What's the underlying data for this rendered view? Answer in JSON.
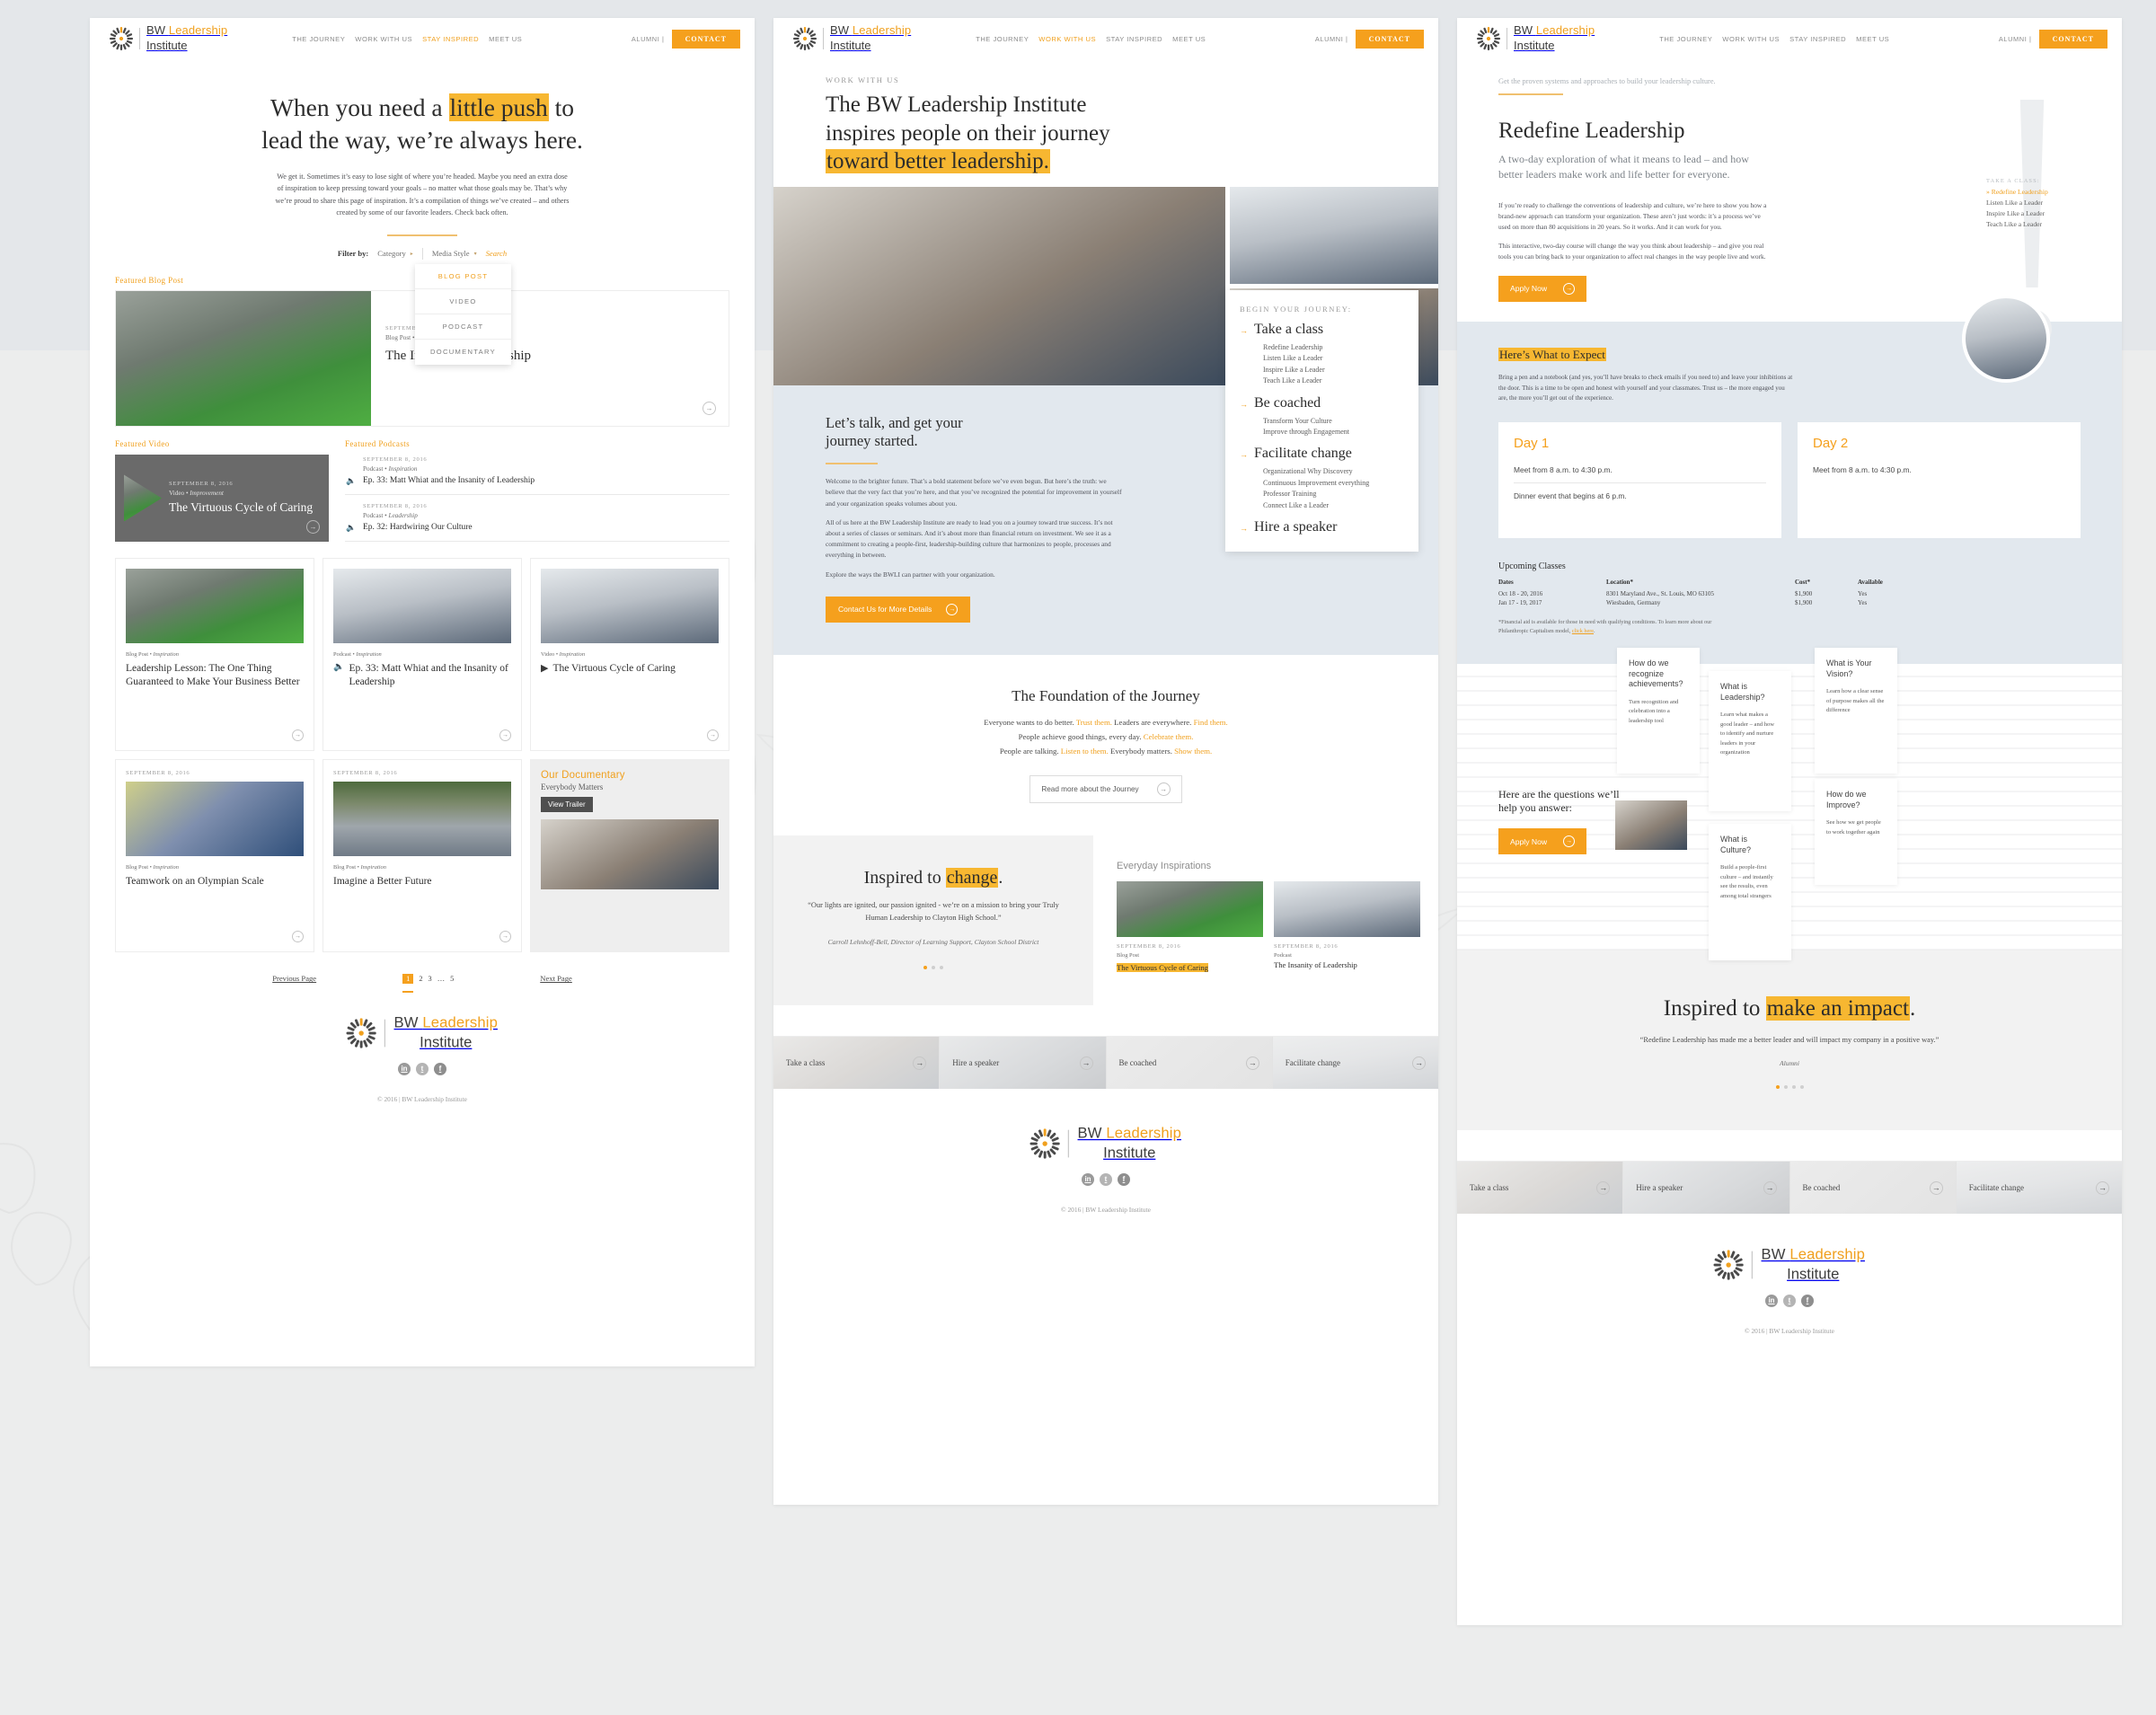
{
  "brand": {
    "line1_plain": "BW ",
    "line1_accent": "Leadership",
    "line2": "Institute",
    "accent_color": "#f0a01e"
  },
  "nav": {
    "items": [
      {
        "label": "THE JOURNEY",
        "active": false
      },
      {
        "label": "WORK WITH US",
        "active": false
      },
      {
        "label": "STAY INSPIRED",
        "active": true
      },
      {
        "label": "MEET US",
        "active": false
      }
    ],
    "alumni_label": "ALUMNI |",
    "contact_label": "CONTACT"
  },
  "nav2": {
    "items": [
      {
        "label": "THE JOURNEY",
        "active": false
      },
      {
        "label": "WORK WITH US",
        "active": true
      },
      {
        "label": "STAY INSPIRED",
        "active": false
      },
      {
        "label": "MEET US",
        "active": false
      }
    ]
  },
  "nav3": {
    "items": [
      {
        "label": "THE JOURNEY",
        "active": false
      },
      {
        "label": "WORK WITH US",
        "active": false
      },
      {
        "label": "STAY INSPIRED",
        "active": false
      },
      {
        "label": "MEET US",
        "active": false
      }
    ]
  },
  "panel1": {
    "hero_before": "When you need a ",
    "hero_highlight": "little push",
    "hero_after": " to",
    "hero_line2": "lead the way, we’re always here.",
    "intro": "We get it. Sometimes it’s easy to lose sight of where you’re headed. Maybe you need an extra dose of inspiration to keep pressing toward your goals – no matter what those goals may be. That’s why we’re proud to share this page of inspiration. It’s a compilation of things we’ve created – and others created by some of our favorite leaders. Check back often.",
    "filter": {
      "label": "Filter by:",
      "category_label": "Category",
      "media_label": "Media Style",
      "search_label": "Search",
      "dropdown_items": [
        {
          "label": "BLOG POST",
          "selected": true
        },
        {
          "label": "VIDEO",
          "selected": false
        },
        {
          "label": "PODCAST",
          "selected": false
        },
        {
          "label": "DOCUMENTARY",
          "selected": false
        }
      ]
    },
    "featured_blog_label": "Featured Blog Post",
    "featured_blog": {
      "date": "SEPTEMBER 8, 2016",
      "category": "Blog Post",
      "tag": "Inspiration",
      "title": "The Insanity of Leadership"
    },
    "featured_video_label": "Featured Video",
    "featured_video": {
      "date": "SEPTEMBER 8, 2016",
      "category": "Video",
      "tag": "Improvement",
      "title": "The Virtuous Cycle of Caring"
    },
    "featured_podcasts_label": "Featured Podcasts",
    "podcasts": [
      {
        "date": "SEPTEMBER 8, 2016",
        "category": "Podcast",
        "tag": "Inspiration",
        "title": "Ep. 33: Matt Whiat and the Insanity of Leadership"
      },
      {
        "date": "SEPTEMBER 8, 2016",
        "category": "Podcast",
        "tag": "Leadership",
        "title": "Ep. 32: Hardwiring Our Culture"
      }
    ],
    "cards": [
      {
        "date": "",
        "category": "Blog Post",
        "tag": "Inspiration",
        "title": "Leadership Lesson: The One Thing Guaranteed to Make Your Business Better",
        "icon": ""
      },
      {
        "date": "",
        "category": "Podcast",
        "tag": "Inspiration",
        "title": "Ep. 33: Matt Whiat and the Insanity of Leadership",
        "icon": "speaker"
      },
      {
        "date": "",
        "category": "Video",
        "tag": "Inspiration",
        "title": "The Virtuous Cycle of Caring",
        "icon": "play"
      },
      {
        "date": "SEPTEMBER 8, 2016",
        "category": "Blog Post",
        "tag": "Inspiration",
        "title": "Teamwork on an Olympian Scale",
        "icon": ""
      },
      {
        "date": "SEPTEMBER 8, 2016",
        "category": "Blog Post",
        "tag": "Inspiration",
        "title": "Imagine a Better Future",
        "icon": ""
      }
    ],
    "documentary": {
      "title": "Our Documentary",
      "subtitle": "Everybody Matters",
      "button": "View Trailer"
    },
    "pager": {
      "prev": "Previous Page",
      "next": "Next Page",
      "pages": [
        "1",
        "2",
        "3",
        "…",
        "5"
      ],
      "current": "1"
    },
    "copyright": "© 2016 | BW Leadership Institute",
    "socials": [
      "in",
      "t",
      "f"
    ]
  },
  "panel2": {
    "eyebrow": "WORK WITH US",
    "hero_line1": "The BW Leadership Institute",
    "hero_line2": "inspires people on their journey",
    "hero_highlight": "toward better leadership.",
    "journey_card": {
      "eyebrow": "BEGIN YOUR JOURNEY:",
      "groups": [
        {
          "title": "Take a class",
          "items": [
            "Redefine Leadership",
            "Listen Like a Leader",
            "Inspire Like a Leader",
            "Teach Like a Leader"
          ]
        },
        {
          "title": "Be coached",
          "items": [
            "Transform Your Culture",
            "Improve through Engagement"
          ]
        },
        {
          "title": "Facilitate change",
          "items": [
            "Organizational Why Discovery",
            "Continuous Improvement everything",
            "Professor Training",
            "Connect Like a Leader"
          ]
        },
        {
          "title": "Hire a speaker",
          "items": []
        }
      ]
    },
    "talk": {
      "heading_l1": "Let’s talk, and get your",
      "heading_l2": "journey started.",
      "p1": "Welcome to the brighter future. That’s a bold statement before we’ve even begun. But here’s the truth: we believe that the very fact that you’re here, and that you’ve recognized the potential for improvement in yourself and your organization speaks volumes about you.",
      "p2": "All of us here at the BW Leadership Institute are ready to lead you on a journey toward true success. It’s not about a series of classes or seminars. And it’s about more than financial return on investment. We see it as a commitment to creating a people-first, leadership-building culture that harmonizes to people, processes and everything in between.",
      "p3": "Explore the ways the BWLI can partner with your organization.",
      "cta": "Contact Us for More Details"
    },
    "foundation": {
      "heading": "The Foundation of the Journey",
      "lines": [
        [
          {
            "t": "Everyone wants to do better. ",
            "a": false
          },
          {
            "t": "Trust them.",
            "a": true
          },
          {
            "t": "  Leaders are everywhere. ",
            "a": false
          },
          {
            "t": "Find them.",
            "a": true
          }
        ],
        [
          {
            "t": "People achieve good things, every day. ",
            "a": false
          },
          {
            "t": "Celebrate them.",
            "a": true
          }
        ],
        [
          {
            "t": "People are talking. ",
            "a": false
          },
          {
            "t": "Listen to them.",
            "a": true
          },
          {
            "t": " Everybody matters. ",
            "a": false
          },
          {
            "t": "Show them.",
            "a": true
          }
        ]
      ],
      "button": "Read more about the Journey"
    },
    "quote": {
      "heading_before": "Inspired to ",
      "heading_highlight": "change",
      "heading_after": ".",
      "text": "“Our lights are ignited, our passion ignited - we’re on a mission to bring your Truly Human Leadership to Clayton High School.”",
      "attribution": "Carroll Lehnhoff-Bell, Director of Learning Support, Clayton School District",
      "dots": 3,
      "active_dot": 1
    },
    "everyday": {
      "heading": "Everyday Inspirations",
      "items": [
        {
          "date": "SEPTEMBER 8, 2016",
          "category": "Blog Post",
          "title": "The Virtuous Cycle of Caring",
          "highlight": true
        },
        {
          "date": "SEPTEMBER 8, 2016",
          "category": "Podcast",
          "title": "The Insanity of Leadership",
          "highlight": false
        }
      ]
    },
    "tiles": [
      "Take a class",
      "Hire a  speaker",
      "Be coached",
      "Facilitate change"
    ],
    "copyright": "© 2016 | BW Leadership Institute"
  },
  "panel3": {
    "kicker": "Get the proven systems and approaches to build your leadership culture.",
    "title": "Redefine Leadership",
    "lede": "A two-day exploration of what it means to lead – and how better leaders make work and life better for everyone.",
    "p1": "If you’re ready to challenge the conventions of leadership and culture, we’re here to show you how a brand-new approach can transform your organization. These aren’t just words: it’s a process we’ve used on more than 80 acquisitions in 20 years. So it works. And it can work for you.",
    "p2": "This interactive, two-day course will change the way you think about leadership – and give you real tools you can bring back to your organization to affect real changes in the way people live and work.",
    "apply_label": "Apply Now",
    "take_a_class": {
      "label": "TAKE A CLASS:",
      "current": "Redefine Leadership",
      "others": [
        "Listen Like a Leader",
        "Inspire Like a Leader",
        "Teach Like a Leader"
      ]
    },
    "expect": {
      "heading": "Here’s What to Expect",
      "text": "Bring a pen and a notebook (and yes, you’ll have breaks to check emails if you need to) and leave your inhibitions at the door. This is a time to be open and honest with yourself and your classmates. Trust us – the more engaged you are, the more you’ll get out of the experience.",
      "days": [
        {
          "title": "Day 1",
          "line1": "Meet from 8 a.m. to 4:30 p.m.",
          "line2": "Dinner event that begins at 6 p.m."
        },
        {
          "title": "Day 2",
          "line1": "Meet from 8 a.m. to 4:30 p.m.",
          "line2": ""
        }
      ]
    },
    "upcoming": {
      "heading": "Upcoming Classes",
      "columns": [
        "Dates",
        "Location*",
        "Cost*",
        "Available"
      ],
      "rows": [
        [
          "Oct 18 - 20, 2016",
          "8301 Maryland Ave., St. Louis, MO 63105",
          "$1,900",
          "Yes"
        ],
        [
          "Jan 17 - 19, 2017",
          "Wiesbaden, Germany",
          "$1,900",
          "Yes"
        ]
      ],
      "fineprint_before": "*Financial aid is available for those in need with qualifying conditions. To learn more about our Philanthropic Capitalism model, ",
      "fineprint_link": "click here",
      "fineprint_after": "."
    },
    "questions": {
      "heading": "Here are the questions we’ll help you answer:",
      "apply_label": "Apply Now",
      "cards": [
        {
          "title": "How do we recognize achievements?",
          "body": "Turn recognition and celebration into a leadership tool"
        },
        {
          "title": "What is Leadership?",
          "body": "Learn what makes a good leader – and how to identify and nurture leaders in your organization"
        },
        {
          "title": "What is Your Vision?",
          "body": "Learn how a clear sense of purpose makes all the difference"
        },
        {
          "title": "What is Culture?",
          "body": "Build a people-first culture – and instantly see the results, even among total strangers"
        },
        {
          "title": "How do we Improve?",
          "body": "See how we get people to work together again"
        }
      ]
    },
    "quote": {
      "heading_before": "Inspired to ",
      "heading_highlight": "make an impact",
      "heading_after": ".",
      "text": "“Redefine Leadership has made me a better leader and will impact my company in a positive way.”",
      "attribution": "Alumni",
      "dots": 4,
      "active_dot": 1
    },
    "tiles": [
      "Take a class",
      "Hire a  speaker",
      "Be coached",
      "Facilitate change"
    ],
    "copyright": "© 2016 | BW Leadership Institute"
  }
}
